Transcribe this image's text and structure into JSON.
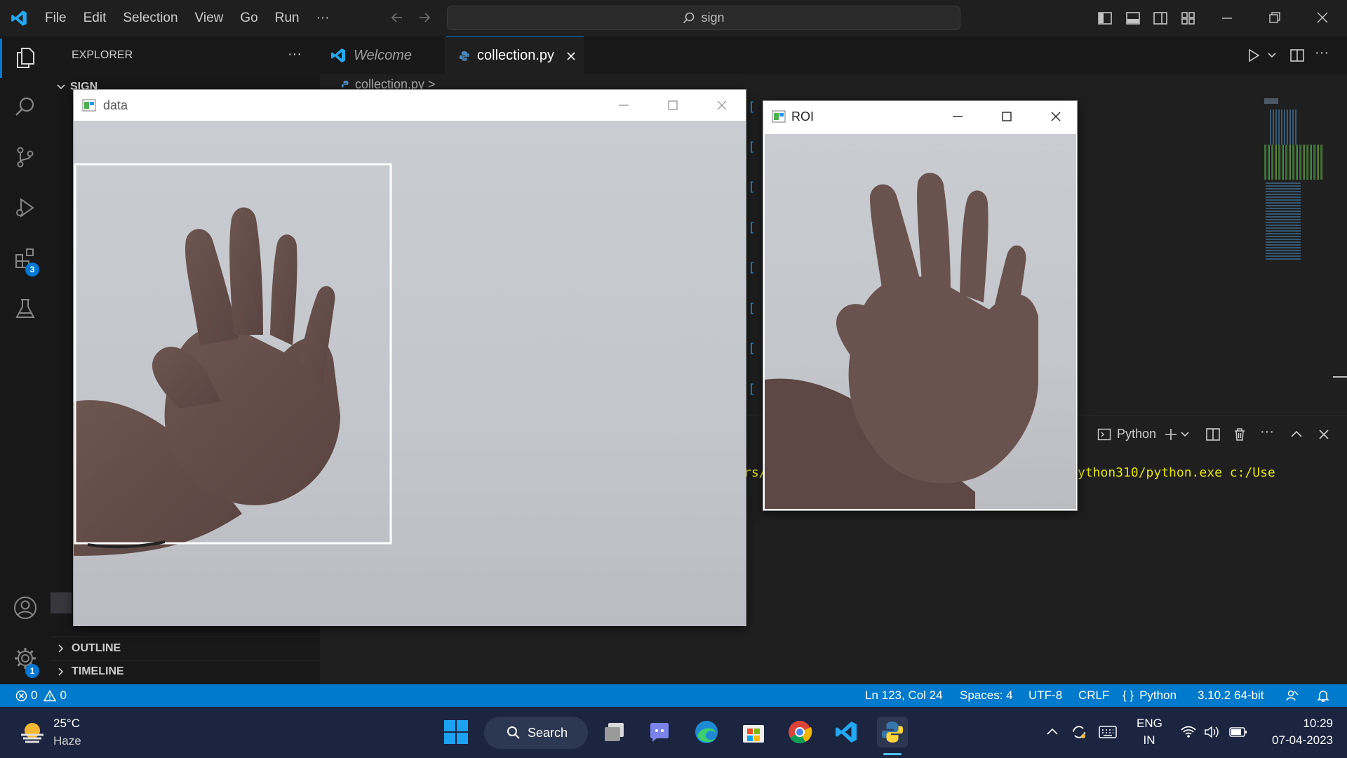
{
  "menu": [
    "File",
    "Edit",
    "Selection",
    "View",
    "Go",
    "Run",
    "···"
  ],
  "command_center": "sign",
  "sidebar": {
    "title": "EXPLORER",
    "more": "···",
    "folder": "SIGN",
    "sections": [
      "OUTLINE",
      "TIMELINE"
    ]
  },
  "activity": {
    "extensions_badge": "3",
    "settings_badge": "1"
  },
  "tabs": [
    {
      "label": "Welcome"
    },
    {
      "label": "collection.py"
    }
  ],
  "breadcrumb": "collection.py >",
  "panel": {
    "terminal_name": "Python",
    "terminal_line_fragment_left": "rs/",
    "terminal_line_fragment_right": "ython310/python.exe c:/Use"
  },
  "windows": {
    "data_title": "data",
    "roi_title": "ROI"
  },
  "status": {
    "errors": "0",
    "warnings": "0",
    "position": "Ln 123, Col 24",
    "spaces": "Spaces: 4",
    "encoding": "UTF-8",
    "eol": "CRLF",
    "language": "Python",
    "interpreter": "3.10.2 64-bit"
  },
  "taskbar": {
    "temp": "25°C",
    "weather": "Haze",
    "search": "Search",
    "lang1": "ENG",
    "lang2": "IN",
    "time": "10:29",
    "date": "07-04-2023"
  },
  "colors": {
    "accent": "#007acc",
    "vscode_blue": "#23a9f2",
    "terminal_yellow": "#e5e510"
  }
}
